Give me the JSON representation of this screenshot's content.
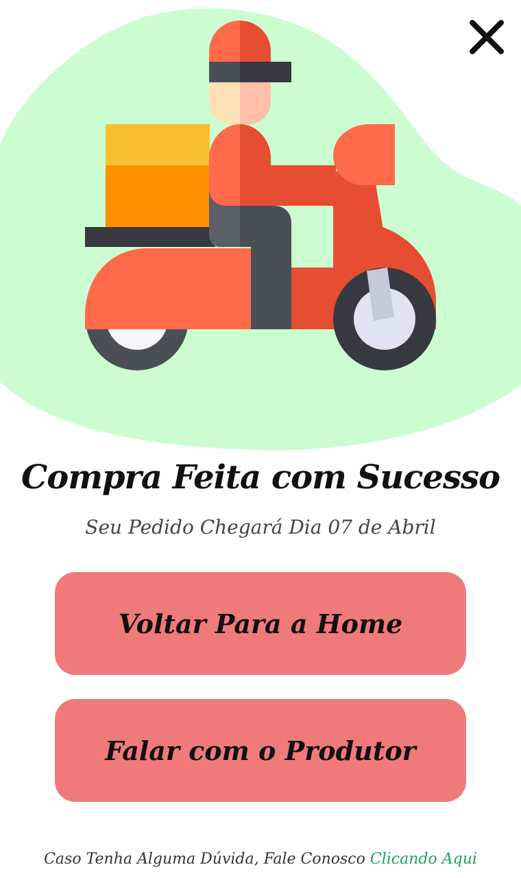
{
  "colors": {
    "blob": "#ccfdd1",
    "button_bg": "#f07a7a",
    "link": "#1aa35b"
  },
  "icons": {
    "close": "close-icon",
    "illustration": "delivery-scooter-illustration"
  },
  "title": "Compra Feita com Sucesso",
  "subtitle": "Seu Pedido Chegará Dia 07 de Abril",
  "buttons": {
    "home_label": "Voltar Para a Home",
    "producer_label": "Falar com o Produtor"
  },
  "footer": {
    "text": "Caso Tenha Alguma Dúvida, Fale Conosco",
    "link_label": "Clicando Aqui"
  }
}
